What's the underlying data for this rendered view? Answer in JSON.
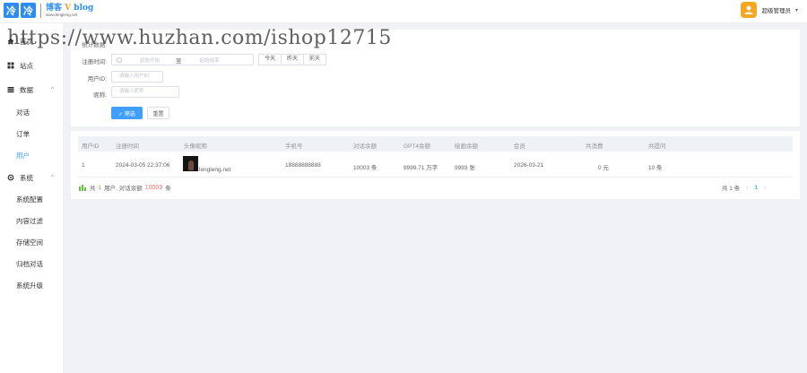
{
  "brand": {
    "tile1": "冷",
    "tile2": "冷",
    "name_main": "博客",
    "name_v": "V",
    "name_end": "blog",
    "sub": "www.lengleng.net"
  },
  "user": {
    "name": "超级管理员",
    "caret": "▾"
  },
  "watermark": "https://www.huzhan.com/ishop12715",
  "sidebar": {
    "home": "首页",
    "site": "站点",
    "data": "数据",
    "data_items": [
      "对话",
      "订单",
      "用户"
    ],
    "system": "系统",
    "system_items": [
      "系统配置",
      "内容过滤",
      "存储空间",
      "归档对话",
      "系统升级"
    ],
    "arrow": "^"
  },
  "filter": {
    "summary_label": "统计数据:",
    "reg_time_label": "注册时间:",
    "start_placeholder": "起始开始",
    "range_separator": "至",
    "end_placeholder": "起始结束",
    "quick": [
      "今天",
      "昨天",
      "前天"
    ],
    "uid_label": "用户ID:",
    "uid_placeholder": "请输入用户ID",
    "nick_label": "昵称:",
    "nick_placeholder": "请输入昵称",
    "search_button": "✓ 筛选",
    "reset_button": "重置"
  },
  "table": {
    "columns": [
      "用户ID",
      "注册时间",
      "头像昵称",
      "手机号",
      "对话余额",
      "GPT4余额",
      "绘画余额",
      "会员",
      "共消费",
      "共提问"
    ],
    "rows": [
      {
        "id": "1",
        "reg_time": "2024-03-05 22:37:06",
        "nickname": "lengleng.net",
        "phone": "18888888888",
        "chat_balance": "10003 条",
        "gpt4_balance": "9999.71 万字",
        "draw_balance": "9993 张",
        "vip": "2026-03-21",
        "spent": "0 元",
        "questions": "10 条"
      }
    ]
  },
  "summary": {
    "prefix": "共",
    "count": "1",
    "middle": "用户, 对话余额",
    "balance": "10003",
    "suffix": "条"
  },
  "pagination": {
    "total": "共 1 条",
    "prev": "‹",
    "page": "1",
    "next": "›"
  }
}
